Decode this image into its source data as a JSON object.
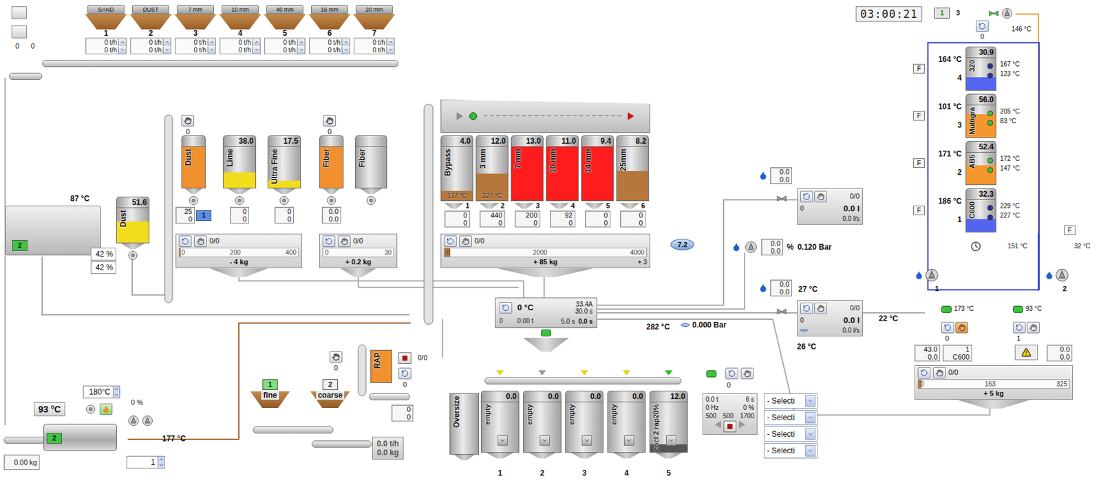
{
  "toolbar": {
    "counters": [
      "0",
      "0"
    ]
  },
  "cold_feed": {
    "bins": [
      {
        "label": "SAND",
        "number": "1",
        "rates": [
          "0 t/h",
          "0 t/h"
        ]
      },
      {
        "label": "DUST",
        "number": "2",
        "rates": [
          "0 t/h",
          "0 t/h"
        ]
      },
      {
        "label": "7 mm",
        "number": "3",
        "rates": [
          "0 t/h",
          "0 t/h"
        ]
      },
      {
        "label": "10 mm",
        "number": "4",
        "rates": [
          "0 t/h",
          "0 t/h"
        ]
      },
      {
        "label": "40 mm",
        "number": "5",
        "rates": [
          "0 t/h",
          "0 t/h"
        ]
      },
      {
        "label": "16 mm",
        "number": "6",
        "rates": [
          "0 t/h",
          "0 t/h"
        ]
      },
      {
        "label": "20 mm",
        "number": "7",
        "rates": [
          "0 t/h",
          "0 t/h"
        ]
      }
    ]
  },
  "dryer": {
    "temp": "87 °C",
    "badge": "2",
    "percents": [
      "42 %",
      "42 %"
    ],
    "dust_silo": {
      "label": "Dust",
      "value": "51.6",
      "level": 0.62,
      "color": "#f2dc1c"
    }
  },
  "filler": {
    "counter": "0",
    "badge": "1",
    "silos": [
      {
        "label": "Dust",
        "value": "",
        "level": 1,
        "color": "#f0902e",
        "readings": [
          "25",
          "0"
        ]
      },
      {
        "label": "Lime",
        "value": "38.0",
        "level": 0.38,
        "color": "#f2dc1c",
        "readings": [
          "0",
          "0"
        ]
      },
      {
        "label": "Ultra Fine",
        "value": "17.5",
        "level": 0.17,
        "color": "#f2dc1c",
        "readings": [
          "0",
          "0"
        ]
      }
    ],
    "scale": {
      "status": "0/0",
      "ticks": [
        "0",
        "200",
        "400"
      ],
      "weight": "- 4 kg",
      "extra": "",
      "level": 0.01
    }
  },
  "fiber": {
    "counter": "0",
    "silos": [
      {
        "label": "Fiber",
        "value": "",
        "level": 1,
        "color": "#f0902e",
        "readings": [
          "0.0",
          "0.0"
        ]
      },
      {
        "label": "Fiber",
        "value": "",
        "level": 0,
        "color": "#f0902e",
        "readings": []
      }
    ],
    "scale": {
      "status": "0/0",
      "ticks": [
        "0",
        "30"
      ],
      "weight": "+ 0.2 kg",
      "extra": "",
      "level": 0
    }
  },
  "hot_bins": {
    "running": true,
    "bins": [
      {
        "label": "Bypass",
        "number": "1",
        "value": "4.0",
        "level": 0.18,
        "color": "#b5773a",
        "temp": "177 °C",
        "readings": [
          "0",
          "0"
        ]
      },
      {
        "label": "3 mm",
        "number": "2",
        "value": "12.0",
        "level": 0.5,
        "color": "#b5773a",
        "temp": "227 °C",
        "readings": [
          "440",
          "0"
        ]
      },
      {
        "label": "7 mm",
        "number": "3",
        "value": "13.0",
        "level": 1,
        "color": "#ff1c1c",
        "temp": "",
        "readings": [
          "200",
          "0"
        ]
      },
      {
        "label": "10 mm",
        "number": "4",
        "value": "11.0",
        "level": 1,
        "color": "#ff1c1c",
        "temp": "",
        "readings": [
          "92",
          "0"
        ]
      },
      {
        "label": "14 mm",
        "number": "5",
        "value": "9.4",
        "level": 1,
        "color": "#ff1c1c",
        "temp": "",
        "readings": [
          "0",
          "0"
        ]
      },
      {
        "label": "25mm",
        "number": "6",
        "value": "8.2",
        "level": 0.55,
        "color": "#b5773a",
        "temp": "",
        "readings": [
          "0",
          "0"
        ]
      }
    ],
    "scale": {
      "status": "0/0",
      "ticks": [
        "0",
        "2000",
        "4000"
      ],
      "weight": "+ 85 kg",
      "extra": "+ 3",
      "level": 0.03
    }
  },
  "mixer": {
    "temp": "0 °C",
    "current": "33.4A",
    "mix_time": "30.0 s",
    "counter": "0",
    "tons": "0.00 t",
    "dry_time": "5.0 s",
    "elapsed": "0.0 s"
  },
  "discharge": {
    "temp": "282 °C",
    "pressure": "0.000 Bar"
  },
  "compressor": {
    "pressure": "7.2"
  },
  "water": {
    "readings": [
      "0.0",
      "0.0"
    ],
    "counter": "0",
    "status": "0/0",
    "volume": "0.0 l",
    "rate": "0.0 l/s"
  },
  "pump": {
    "readings": [
      "0.0",
      "0.0"
    ],
    "unit": "%",
    "pressure": "0.120 Bar"
  },
  "additive": {
    "readings": [
      "0.0",
      "0.0"
    ],
    "temp_in": "27 °C",
    "counter": "0",
    "status": "0/0",
    "volume": "0.0 l",
    "rate": "0.0 l/s",
    "temp_out": "26 °C",
    "line_temp": "22 °C"
  },
  "bitumen": {
    "clock": "03:00:21",
    "badge": "1",
    "count": "3",
    "counter": "0",
    "return_temp": "146 °C",
    "tanks": [
      {
        "label": "320",
        "number": "4",
        "value": "30.9",
        "level": 0.4,
        "color": "#5566ee",
        "indicator": "#23349a",
        "temp": "164 °C",
        "temps": [
          "167 °C",
          "123 °C"
        ],
        "f": "F"
      },
      {
        "label": "Multigra",
        "number": "3",
        "value": "56.0",
        "level": 0.72,
        "color": "#f5962e",
        "indicator": "#3cc43c",
        "temp": "101 °C",
        "temps": [
          "205 °C",
          "83 °C"
        ],
        "f": "F"
      },
      {
        "label": "AB5",
        "number": "2",
        "value": "52.4",
        "level": 0.6,
        "color": "#f5962e",
        "indicator": "#3cc43c",
        "temp": "171 °C",
        "temps": [
          "172 °C",
          "147 °C"
        ],
        "f": "F"
      },
      {
        "label": "C600",
        "number": "1",
        "value": "32.3",
        "level": 0.4,
        "color": "#5566ee",
        "indicator": "#23349a",
        "temp": "186 °C",
        "temps": [
          "229 °C",
          "227 °C"
        ],
        "f": "F"
      }
    ],
    "right_f": "F",
    "flow_temps": [
      "151 °C",
      "32 °C"
    ],
    "pumps": [
      {
        "number": "1",
        "temp": "173 °C",
        "counter": "0",
        "manual": true,
        "warning": false
      },
      {
        "number": "2",
        "temp": "93 °C",
        "counter": "1",
        "manual": false,
        "warning": true
      }
    ],
    "readings": [
      [
        "43.0",
        "0.0"
      ],
      [
        "1",
        "C600"
      ],
      [
        "0.0",
        "0.0"
      ]
    ],
    "scale": {
      "status": "0/0",
      "ticks": [
        "0",
        "163",
        "325"
      ],
      "weight": "+ 5 kg",
      "extra": "",
      "level": 0.02
    }
  },
  "burner": {
    "temp": "93 °C",
    "setpoint": "180°C",
    "power": "0 %",
    "badge": "2",
    "outlet_temp": "177 °C",
    "weight": "0.00 kg",
    "field": "1"
  },
  "rap": {
    "feeders": [
      {
        "number": "1",
        "label": "fine",
        "selected": true
      },
      {
        "number": "2",
        "label": "coarse",
        "selected": false
      }
    ],
    "silo": {
      "label": "RAP",
      "level": 1,
      "color": "#f0902e"
    },
    "counter": "0",
    "status": "0/0",
    "counter2": "0",
    "readings": [
      "0",
      "0"
    ],
    "rate": "0.0 t/h",
    "weight": "0.0 kg"
  },
  "storage": {
    "oversize": "Oversize",
    "counter": "0",
    "silos": [
      {
        "label": "empty",
        "value": "0.0",
        "number": "1",
        "level": 0,
        "color": "#555555",
        "marker_color": "#e8d21a"
      },
      {
        "label": "empty",
        "value": "0.0",
        "number": "2",
        "level": 0,
        "color": "#555555",
        "marker_color": "#9a9a9a"
      },
      {
        "label": "empty",
        "value": "0.0",
        "number": "3",
        "level": 0,
        "color": "#555555",
        "marker_color": "#e8d21a"
      },
      {
        "label": "empty",
        "value": "0.0",
        "number": "4",
        "level": 0,
        "color": "#555555",
        "marker_color": "#e8d21a"
      },
      {
        "label": "cncl 2 rap20%",
        "value": "12.0",
        "number": "5",
        "level": 0.15,
        "color": "#555555",
        "marker_color": "#2ec02e"
      }
    ],
    "loading": {
      "values": [
        "0.0 t",
        "6 s",
        "0 Hz",
        "0 %"
      ],
      "limits": [
        "500",
        "500",
        "1700"
      ]
    },
    "selects": [
      "- Selecti",
      "- Selecti",
      "- Selecti",
      "- Selecti"
    ]
  }
}
